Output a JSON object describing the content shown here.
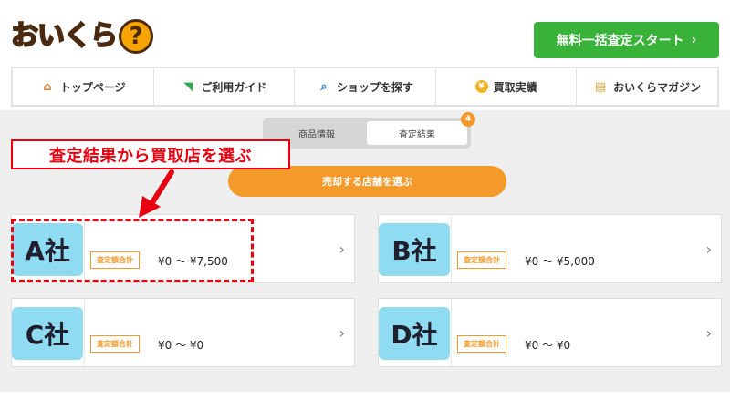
{
  "header": {
    "logo_text": "おいくら",
    "logo_mark": "?",
    "cta_label": "無料一括査定スタート",
    "cta_chevron": "›"
  },
  "nav": {
    "items": [
      {
        "label": "トップページ",
        "icon": "home-icon",
        "glyph": "⌂"
      },
      {
        "label": "ご利用ガイド",
        "icon": "guide-leaf-icon",
        "glyph": "◥"
      },
      {
        "label": "ショップを探す",
        "icon": "search-icon",
        "glyph": "⌕"
      },
      {
        "label": "買取実績",
        "icon": "yen-coin-icon",
        "glyph": "¥"
      },
      {
        "label": "おいくらマガジン",
        "icon": "magazine-icon",
        "glyph": "▤"
      }
    ]
  },
  "tabs": {
    "items": [
      {
        "label": "商品情報",
        "active": false
      },
      {
        "label": "査定結果",
        "active": true
      }
    ],
    "badge": "4"
  },
  "annotation": {
    "text": "査定結果から買取店を選ぶ",
    "color": "#e60012"
  },
  "select_button": {
    "label": "売却する店舗を選ぶ"
  },
  "shops": [
    {
      "name": "A社",
      "badge": "査定額合計",
      "price": "¥0 〜 ¥7,500",
      "chevron": "›"
    },
    {
      "name": "B社",
      "badge": "査定額合計",
      "price": "¥0 〜 ¥5,000",
      "chevron": "›"
    },
    {
      "name": "C社",
      "badge": "査定額合計",
      "price": "¥0 〜 ¥0",
      "chevron": "›"
    },
    {
      "name": "D社",
      "badge": "査定額合計",
      "price": "¥0 〜 ¥0",
      "chevron": "›"
    }
  ],
  "colors": {
    "accent_orange": "#f39a2b",
    "cta_green": "#39b239",
    "thumb_blue": "#8fdcf2",
    "annotation_red": "#e60012"
  }
}
